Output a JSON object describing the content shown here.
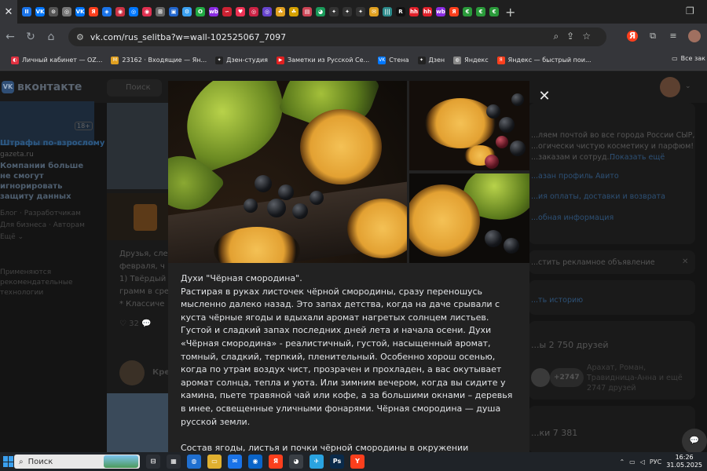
{
  "tabs": {
    "active_close": "✕",
    "items": [
      {
        "glyph": "II",
        "color": "#1a73e8"
      },
      {
        "glyph": "VK",
        "color": "#0077ff"
      },
      {
        "glyph": "⊙",
        "color": "#555555"
      },
      {
        "glyph": "◎",
        "color": "#777777"
      },
      {
        "glyph": "VK",
        "color": "#0077ff"
      },
      {
        "glyph": "Я",
        "color": "#fc3f1d"
      },
      {
        "glyph": "◈",
        "color": "#1a73e8"
      },
      {
        "glyph": "◉",
        "color": "#cc3344"
      },
      {
        "glyph": "◎",
        "color": "#0077ff"
      },
      {
        "glyph": "◉",
        "color": "#e03050"
      },
      {
        "glyph": "⊞",
        "color": "#666666"
      },
      {
        "glyph": "▣",
        "color": "#2266cc"
      },
      {
        "glyph": "⚙",
        "color": "#3aa0f0"
      },
      {
        "glyph": "O",
        "color": "#22aa44"
      },
      {
        "glyph": "wb",
        "color": "#8a2be2"
      },
      {
        "glyph": "∽",
        "color": "#cc2233"
      },
      {
        "glyph": "♥",
        "color": "#ee3355"
      },
      {
        "glyph": "◎",
        "color": "#cc2244"
      },
      {
        "glyph": "◎",
        "color": "#6644cc"
      },
      {
        "glyph": "☘",
        "color": "#e0a020"
      },
      {
        "glyph": "☘",
        "color": "#d4a000"
      },
      {
        "glyph": "▤",
        "color": "#cc4455"
      },
      {
        "glyph": "◕",
        "color": "#1a9a5a"
      },
      {
        "glyph": "✦",
        "color": "#333333"
      },
      {
        "glyph": "✦",
        "color": "#333333"
      },
      {
        "glyph": "✦",
        "color": "#333333"
      },
      {
        "glyph": "✉",
        "color": "#e0a020"
      },
      {
        "glyph": "|||",
        "color": "#2a8a8a"
      },
      {
        "glyph": "R",
        "color": "#111111"
      },
      {
        "glyph": "hh",
        "color": "#e0202a"
      },
      {
        "glyph": "hh",
        "color": "#e0202a"
      },
      {
        "glyph": "wb",
        "color": "#8a2be2"
      },
      {
        "glyph": "Я",
        "color": "#fc3f1d"
      },
      {
        "glyph": "€",
        "color": "#2a9a3a"
      },
      {
        "glyph": "€",
        "color": "#2a9a3a"
      },
      {
        "glyph": "€",
        "color": "#2a9a3a"
      }
    ],
    "new_tab": "+",
    "window_btn": "❐"
  },
  "toolbar": {
    "back": "←",
    "forward": "→",
    "reload": "↻",
    "home": "⌂",
    "site_info": "⚙",
    "url": "vk.com/rus_selitba?w=wall-102525067_7097",
    "zoom_icon": "⌕",
    "share_icon": "⇪",
    "star_icon": "☆",
    "yandex_icon": "Я",
    "extensions_icon": "⧉",
    "queue_icon": "≡"
  },
  "bookmarks": {
    "items": [
      {
        "label": "Личный кабинет — OZ...",
        "glyph": "◐",
        "color": "#e03040"
      },
      {
        "label": "23162 · Входящие — Ян...",
        "glyph": "M",
        "color": "#e0a020"
      },
      {
        "label": "Дзен-студия",
        "glyph": "✦",
        "color": "#222222"
      },
      {
        "label": "Заметки из Русской Се...",
        "glyph": "▶",
        "color": "#e02020"
      },
      {
        "label": "Стена",
        "glyph": "VK",
        "color": "#0077ff"
      },
      {
        "label": "Дзен",
        "glyph": "✦",
        "color": "#222222"
      },
      {
        "label": "Яндекс",
        "glyph": "◍",
        "color": "#888888"
      },
      {
        "label": "Яндекс — быстрый пои...",
        "glyph": "Я",
        "color": "#fc3f1d"
      }
    ],
    "all_label": "Все зак",
    "folder_icon": "▭"
  },
  "vk": {
    "logo_text": "вконтакте",
    "logo_glyph": "VK",
    "search_placeholder": "Поиск",
    "ad": {
      "age": "18+",
      "title": "Штрафы по-взрослому",
      "site": "gazeta.ru",
      "text": "Компании больше не смогут игнорировать защиту данных"
    },
    "left_links": "Блог · Разработчикам Для бизнеса · Авторам Ещё ⌄",
    "left_note": "Применяются рекомендательные технологии",
    "post_text": [
      "Друзья, сле",
      "февраля, ч",
      "1) Твёрдый",
      "грамм в сре",
      "* Классиче"
    ],
    "post_likes": "♡ 32  💬",
    "post_author": "Кре",
    "right": {
      "promo": [
        "...ляем почтой во все города России СЫР,",
        "...огически чистую косметику и парфюм!",
        "...заказам и сотруд..."
      ],
      "promo_more": "Показать ещё",
      "link1": "...азан профиль Авито",
      "link2": "...ия оплаты, доставки и возврата",
      "link3": "...обная информация",
      "ad_create": "...стить рекламное объявление",
      "story": "...ть историю",
      "friends_title": "...ы 2 750 друзей",
      "friends_badge": "+2747",
      "friends_desc": [
        "Арахат, Роман,",
        "Травидница-Анна и ещё",
        "2747 друзей"
      ],
      "clips": "...ки 7 381"
    },
    "chat_icon": "💬"
  },
  "modal": {
    "close": "✕",
    "paragraphs": [
      "Духи \"Чёрная смородина\".\nРастирая в руках листочек чёрной смородины, сразу переношусь мысленно далеко назад. Это запах детства, когда на даче срывали с куста чёрные ягоды и вдыхали аромат нагретых солнцем листьев. Густой и сладкий запах последних дней лета и начала осени. Духи «Чёрная смородина» - реалистичный, густой, насыщенный аромат, томный, сладкий, терпкий, пленительный. Особенно хорош осенью, когда по утрам воздух чист, прозрачен и прохладен, а вас окутывает аромат солнца, тепла и уюта. Или зимним вечером, когда вы сидите у камина, пьете травяной чай или кофе, а за большими окнами – деревья в инее, освещенные уличными фонарями. Чёрная смородина — душа русской земли.",
      "Состав ягоды, листья и почки чёрной смородины в окружении бергамота, мускуса, уда, мимозы, полыни, дубового мха, бобов тонка и тд. Стойкость"
    ]
  },
  "taskbar": {
    "search_label": "Поиск",
    "search_icon": "⌕",
    "apps": [
      {
        "glyph": "⊟",
        "color": "#2b2f35"
      },
      {
        "glyph": "▦",
        "color": "#2b2f35"
      },
      {
        "glyph": "◍",
        "color": "#1f6fd0"
      },
      {
        "glyph": "▭",
        "color": "#e0b030"
      },
      {
        "glyph": "✉",
        "color": "#1a73e8"
      },
      {
        "glyph": "◉",
        "color": "#0a64c8"
      },
      {
        "glyph": "Я",
        "color": "#fc3f1d"
      },
      {
        "glyph": "◕",
        "color": "#3a3f45"
      },
      {
        "glyph": "✈",
        "color": "#2aa3e0"
      },
      {
        "glyph": "Ps",
        "color": "#0a2a4a"
      },
      {
        "glyph": "Y",
        "color": "#fc3f1d"
      }
    ],
    "tray_chevron": "⌃",
    "lang": "РУС",
    "time": "16:26",
    "date": "31.05.2025"
  }
}
